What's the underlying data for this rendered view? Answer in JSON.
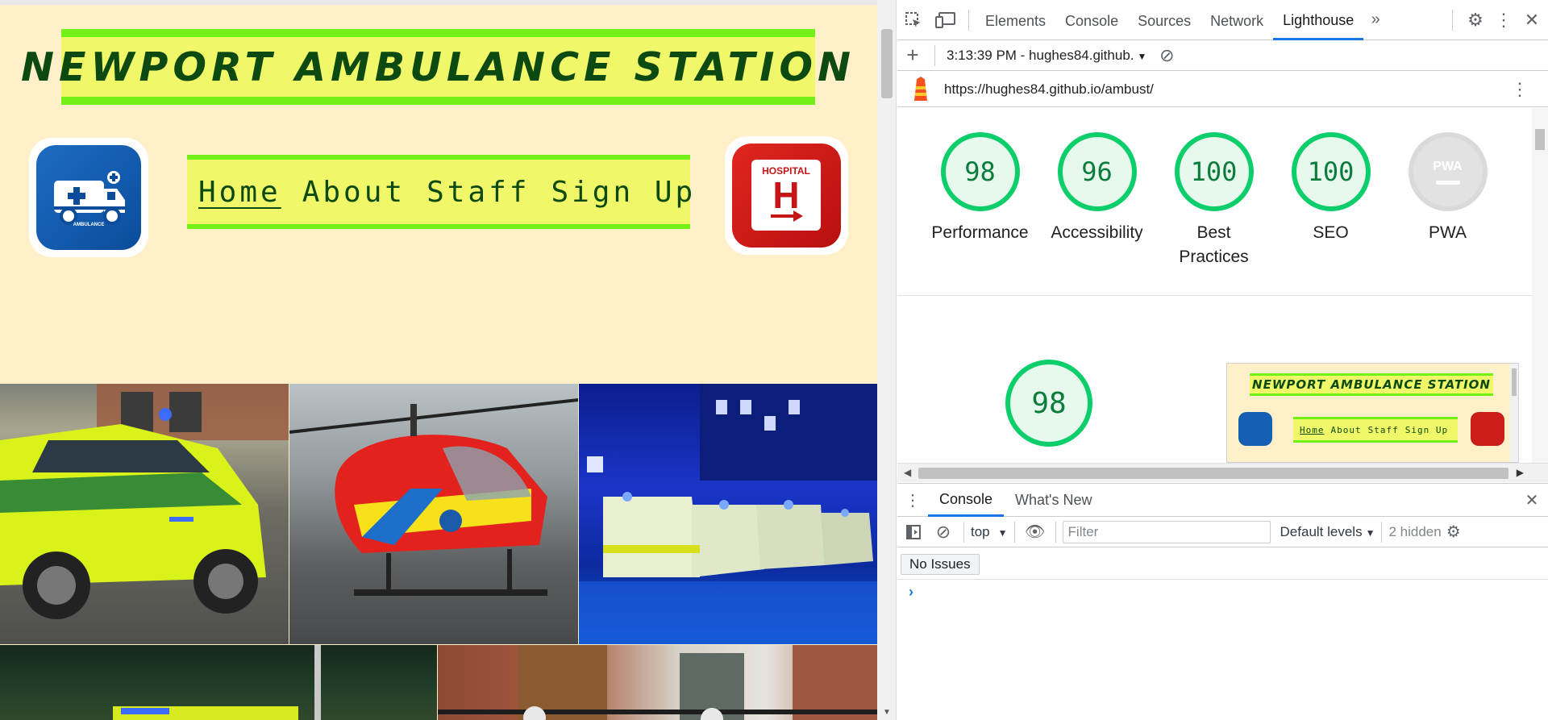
{
  "site": {
    "title": "NEWPORT AMBULANCE STATION",
    "nav": [
      "Home",
      "About",
      "Staff",
      "Sign Up"
    ],
    "active_nav": "Home",
    "logo_left_text": "AMBULANCE",
    "logo_right_text": "HOSPITAL",
    "logo_right_letter": "H"
  },
  "devtools": {
    "tabs": [
      "Elements",
      "Console",
      "Sources",
      "Network",
      "Lighthouse"
    ],
    "active_tab": "Lighthouse",
    "report_selector": "3:13:39 PM - hughes84.github.",
    "report_url": "https://hughes84.github.io/ambust/",
    "scores": [
      {
        "label": "Performance",
        "value": "98"
      },
      {
        "label": "Accessibility",
        "value": "96"
      },
      {
        "label": "Best Practices",
        "value": "100"
      },
      {
        "label": "SEO",
        "value": "100"
      }
    ],
    "pwa_label": "PWA",
    "pwa_badge": "PWA",
    "main_score": "98",
    "drawer_tabs": [
      "Console",
      "What's New"
    ],
    "context": "top",
    "filter_placeholder": "Filter",
    "levels": "Default levels",
    "hidden": "2 hidden",
    "issues": "No Issues",
    "prompt": "›"
  },
  "colors": {
    "page_bg": "#fff0c9",
    "banner_yellow": "#f0f768",
    "banner_green": "#74f019",
    "title_green": "#0d4a12",
    "score_green": "#0cce6b",
    "accent_blue": "#1a73e8"
  }
}
